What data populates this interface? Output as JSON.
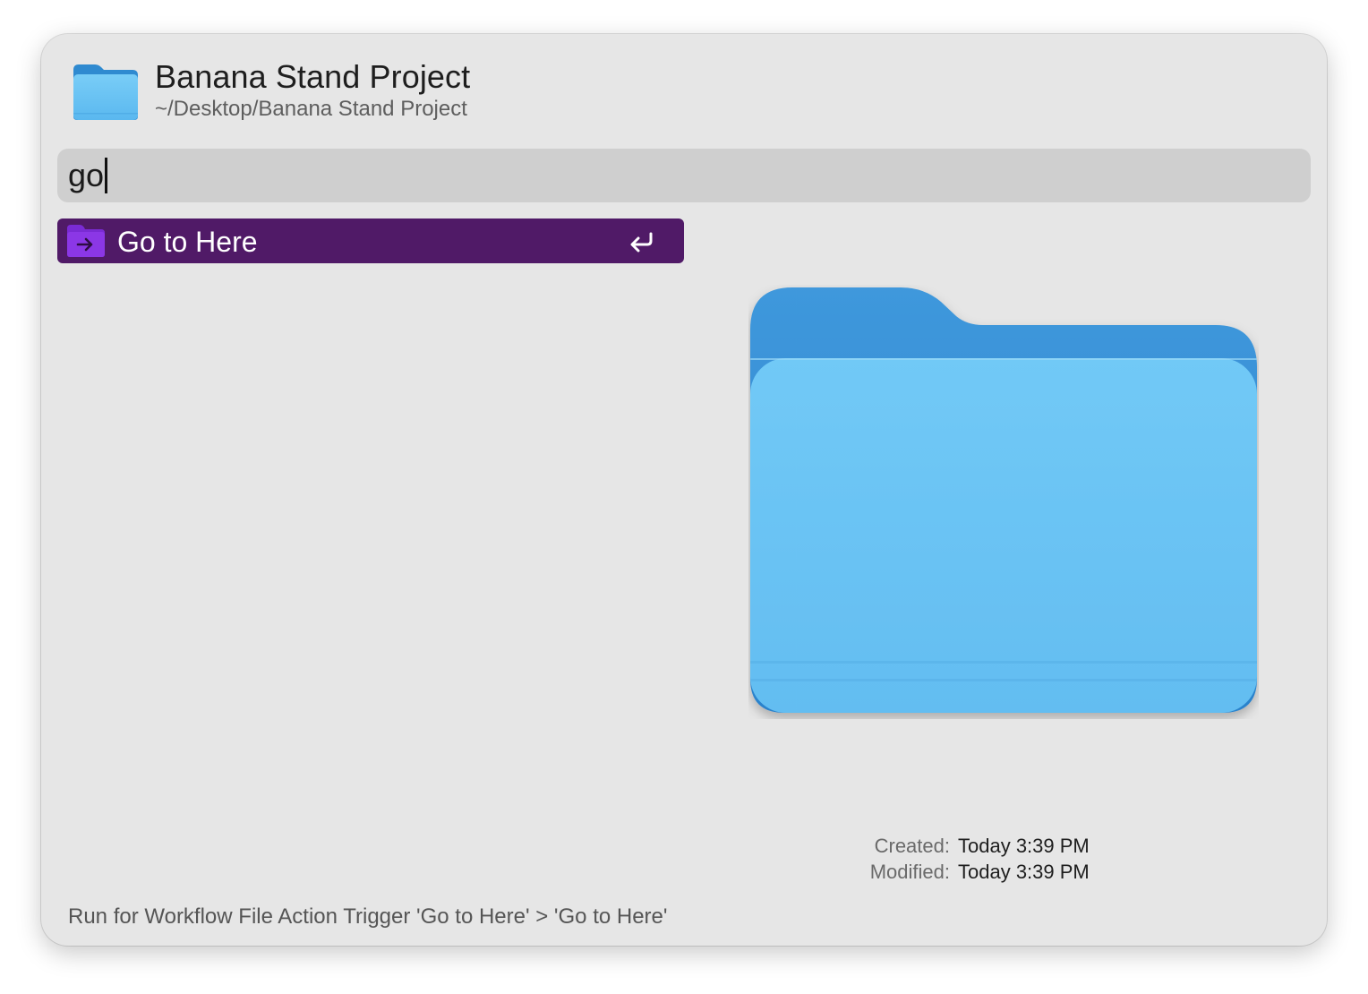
{
  "header": {
    "title": "Banana Stand Project",
    "path": "~/Desktop/Banana Stand Project",
    "icon": "folder-icon"
  },
  "search": {
    "query": "go"
  },
  "results": [
    {
      "label": "Go to Here",
      "icon": "folder-arrow-icon",
      "shortcut_icon": "return-key-icon",
      "selected": true
    }
  ],
  "preview": {
    "icon": "folder-icon",
    "created_label": "Created:",
    "created_value": "Today 3:39 PM",
    "modified_label": "Modified:",
    "modified_value": "Today 3:39 PM"
  },
  "footer": {
    "status": "Run for Workflow File Action Trigger 'Go to Here' > 'Go to Here'"
  },
  "colors": {
    "window_bg": "#e6e6e6",
    "search_bg": "#cfcfcf",
    "selection": "#501a67",
    "folder_front": "#69c4f3",
    "folder_back": "#2b86cc",
    "result_icon": "#7a2bd4"
  }
}
